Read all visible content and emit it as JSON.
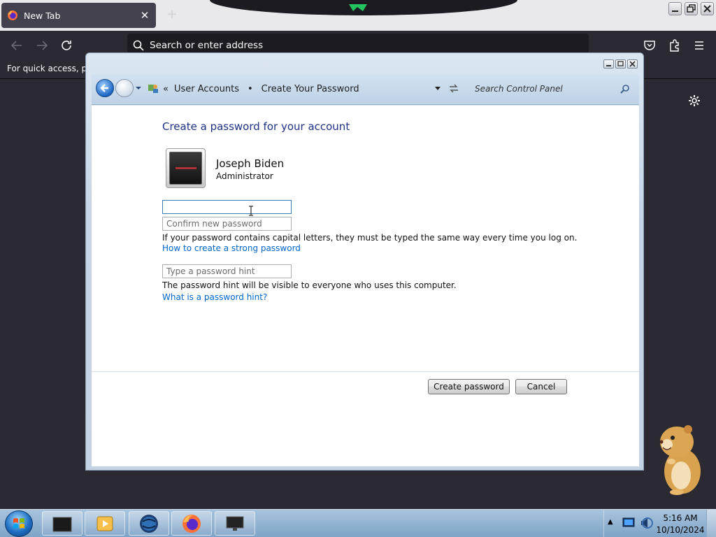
{
  "browser": {
    "tab_title": "New Tab",
    "tab_close_icon": "close-icon",
    "new_tab_icon": "plus-icon",
    "address_placeholder": "Search or enter address",
    "bookmarks_hint": "For quick access, plac",
    "toolbar_icons": [
      "back-arrow-icon",
      "forward-arrow-icon",
      "reload-icon",
      "pocket-icon",
      "extensions-icon",
      "menu-icon"
    ],
    "window_buttons": [
      "minimize-icon",
      "restore-icon",
      "close-icon"
    ]
  },
  "control_panel": {
    "breadcrumb": {
      "parent": "User Accounts",
      "current": "Create Your Password",
      "overflow": "«"
    },
    "search_placeholder": "Search Control Panel",
    "title": "Create a password for your account",
    "account": {
      "name": "Joseph Biden",
      "role": "Administrator"
    },
    "fields": {
      "new_password_value": "",
      "confirm_placeholder": "Confirm new password",
      "hint_placeholder": "Type a password hint"
    },
    "capital_note": "If your password contains capital letters, they must be typed the same way every time you log on.",
    "strong_link": "How to create a strong password",
    "hint_note": "The password hint will be visible to everyone who uses this computer.",
    "hint_link": "What is a password hint?",
    "buttons": {
      "create": "Create password",
      "cancel": "Cancel"
    }
  },
  "taskbar": {
    "apps": [
      "dark-window-icon",
      "media-player-icon",
      "globe-icon",
      "firefox-icon",
      "computer-screen-icon"
    ],
    "time": "5:16 AM",
    "date": "10/10/2024"
  },
  "colors": {
    "firefox_dark": "#2b2a33",
    "cp_title_blue": "#1e3287",
    "link_blue": "#0066cc",
    "taskbar_blue": "#7fa4c7"
  }
}
